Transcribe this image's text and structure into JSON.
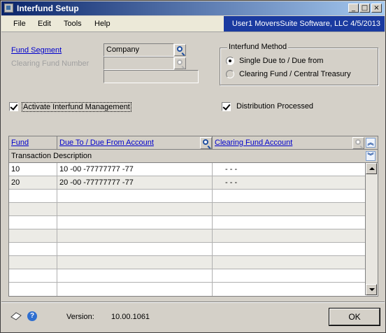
{
  "window": {
    "title": "Interfund Setup",
    "controls": {
      "minimize": "_",
      "maximize": "□",
      "close": "×"
    }
  },
  "menu": {
    "items": [
      "File",
      "Edit",
      "Tools",
      "Help"
    ],
    "info": "User1  MoversSuite Software, LLC  4/5/2013"
  },
  "form": {
    "fund_segment_label": "Fund Segment",
    "fund_segment_value": "Company",
    "clearing_fund_label": "Clearing Fund Number",
    "clearing_fund_value": "",
    "activate_label": "Activate Interfund Management",
    "activate_checked": true,
    "distribution_label": "Distribution Processed",
    "distribution_checked": true
  },
  "method": {
    "title": "Interfund Method",
    "option1": "Single Due to / Due from",
    "option2": "Clearing Fund / Central Treasury",
    "selected": "option1"
  },
  "grid": {
    "col_fund": "Fund",
    "col_due": "Due To / Due From Account",
    "col_clearing": "Clearing Fund Account",
    "row2_header": "Transaction Description",
    "rows": [
      {
        "fund": "10",
        "due": "10 -00 -77777777 -77",
        "clearing": "-    -              -"
      },
      {
        "fund": "20",
        "due": "20 -00 -77777777 -77",
        "clearing": "-    -              -"
      },
      {
        "fund": "",
        "due": "",
        "clearing": ""
      },
      {
        "fund": "",
        "due": "",
        "clearing": ""
      },
      {
        "fund": "",
        "due": "",
        "clearing": ""
      },
      {
        "fund": "",
        "due": "",
        "clearing": ""
      },
      {
        "fund": "",
        "due": "",
        "clearing": ""
      },
      {
        "fund": "",
        "due": "",
        "clearing": ""
      },
      {
        "fund": "",
        "due": "",
        "clearing": ""
      }
    ]
  },
  "footer": {
    "version_label": "Version:",
    "version_value": "10.00.1061",
    "ok_label": "OK"
  }
}
